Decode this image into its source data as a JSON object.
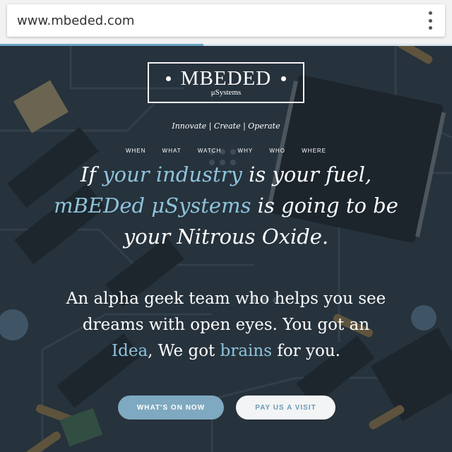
{
  "browser": {
    "url": "www.mbeded.com",
    "menu_icon": "more-vert-icon",
    "load_progress": 0.45
  },
  "colors": {
    "accent": "#8fc3dc",
    "primary_button": "#7fa9c0",
    "secondary_button": "#f3f4f5"
  },
  "hero": {
    "logo": {
      "name": "MBEDED",
      "sub": "μSystems"
    },
    "tagline": "Innovate | Create | Operate",
    "nav": [
      "WHEN",
      "WHAT",
      "WATCH",
      "WHY",
      "WHO",
      "WHERE"
    ],
    "headline": {
      "l1_a": "If ",
      "l1_hl": "your industry",
      "l1_b": " is your fuel,",
      "l2_hl": "mBEDed μSystems",
      "l2_b": " is going to be",
      "l3": "your Nitrous Oxide."
    },
    "sub": {
      "l1": "An alpha geek team who helps you see",
      "l2": "dreams with open eyes. You got an",
      "l3_hl1": "Idea",
      "l3_a": ", We got ",
      "l3_hl2": "brains",
      "l3_b": " for you."
    },
    "buttons": {
      "primary": "WHAT'S ON NOW",
      "secondary": "PAY US A VISIT"
    }
  }
}
